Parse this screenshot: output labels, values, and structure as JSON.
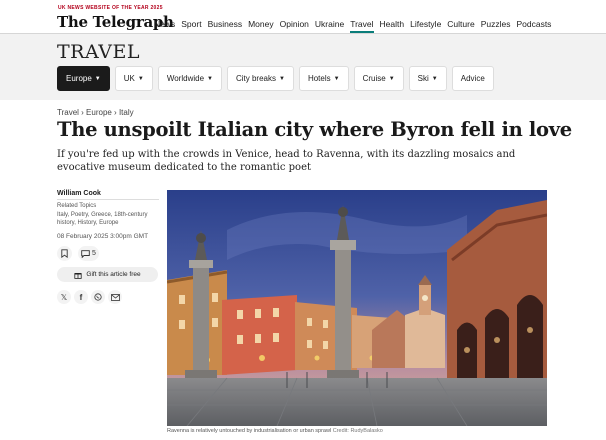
{
  "masthead": {
    "award": "UK NEWS WEBSITE OF THE YEAR 2025",
    "logo": "The Telegraph"
  },
  "topnav": [
    "News",
    "Sport",
    "Business",
    "Money",
    "Opinion",
    "Ukraine",
    "Travel",
    "Health",
    "Lifestyle",
    "Culture",
    "Puzzles",
    "Podcasts"
  ],
  "active_section": "Travel",
  "section": {
    "title": "TRAVEL",
    "pills": [
      {
        "label": "Europe",
        "chevron": true,
        "active": true
      },
      {
        "label": "UK",
        "chevron": true
      },
      {
        "label": "Worldwide",
        "chevron": true
      },
      {
        "label": "City breaks",
        "chevron": true
      },
      {
        "label": "Hotels",
        "chevron": true
      },
      {
        "label": "Cruise",
        "chevron": true
      },
      {
        "label": "Ski",
        "chevron": true
      },
      {
        "label": "Advice",
        "chevron": false
      }
    ]
  },
  "article": {
    "breadcrumb": "Travel › Europe › Italy",
    "headline": "The unspoilt Italian city where Byron fell in love",
    "standfirst": "If you're fed up with the crowds in Venice, head to Ravenna, with its dazzling mosaics and evocative museum dedicated to the romantic poet",
    "author": "William Cook",
    "related_heading": "Related Topics",
    "related_topics": "Italy, Poetry, Greece, 18th-century history, History, Europe",
    "published": "08 February 2025 3:00pm GMT",
    "comment_count": "5",
    "gift_label": "Gift this article free",
    "caption": "Ravenna is relatively untouched by industrialisation or urban sprawl",
    "credit": "Credit: RudyBalasko"
  },
  "colors": {
    "accent": "#0a7d7a",
    "award": "#b3001b",
    "pill_active": "#1b1b1b"
  }
}
